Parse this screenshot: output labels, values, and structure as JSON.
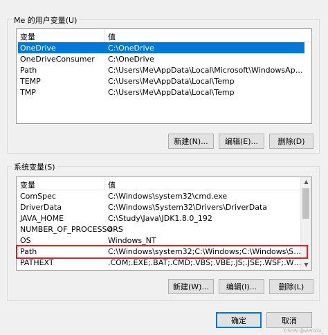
{
  "user_vars": {
    "title": "Me 的用户变量(U)",
    "col_variable": "变量",
    "col_value": "值",
    "rows": [
      {
        "name": "OneDrive",
        "value": "C:\\OneDrive",
        "selected": true
      },
      {
        "name": "OneDriveConsumer",
        "value": "C:\\OneDrive",
        "selected": false
      },
      {
        "name": "Path",
        "value": "C:\\Users\\Me\\AppData\\Local\\Microsoft\\WindowsApps;;C:\\Use...",
        "selected": false
      },
      {
        "name": "TEMP",
        "value": "C:\\Users\\Me\\AppData\\Local\\Temp",
        "selected": false
      },
      {
        "name": "TMP",
        "value": "C:\\Users\\Me\\AppData\\Local\\Temp",
        "selected": false
      }
    ],
    "new_label": "新建(N)...",
    "edit_label": "编辑(E)...",
    "delete_label": "删除(D)"
  },
  "system_vars": {
    "title": "系统变量(S)",
    "col_variable": "变量",
    "col_value": "值",
    "rows": [
      {
        "name": "ComSpec",
        "value": "C:\\Windows\\system32\\cmd.exe"
      },
      {
        "name": "DriverData",
        "value": "C:\\Windows\\System32\\Drivers\\DriverData"
      },
      {
        "name": "JAVA_HOME",
        "value": "C:\\Study\\Java\\JDK1.8.0_192"
      },
      {
        "name": "NUMBER_OF_PROCESSORS",
        "value": "4"
      },
      {
        "name": "OS",
        "value": "Windows_NT"
      },
      {
        "name": "Path",
        "value": "C:\\Windows\\system32;C:\\Windows;C:\\Windows\\System32\\Wb..."
      },
      {
        "name": "PATHEXT",
        "value": ".COM;.EXE;.BAT;.CMD;.VBS;.VBE;.JS;.JSE;.WSF;.WSH;.MSC"
      }
    ],
    "new_label": "新建(W)...",
    "edit_label": "编辑(I)...",
    "delete_label": "删除(L)"
  },
  "ok_label": "确定",
  "cancel_label": "取消",
  "watermark": "CSDN @wenxiu_",
  "colors": {
    "selection": "#0078d7",
    "highlight_box": "#e02020"
  }
}
